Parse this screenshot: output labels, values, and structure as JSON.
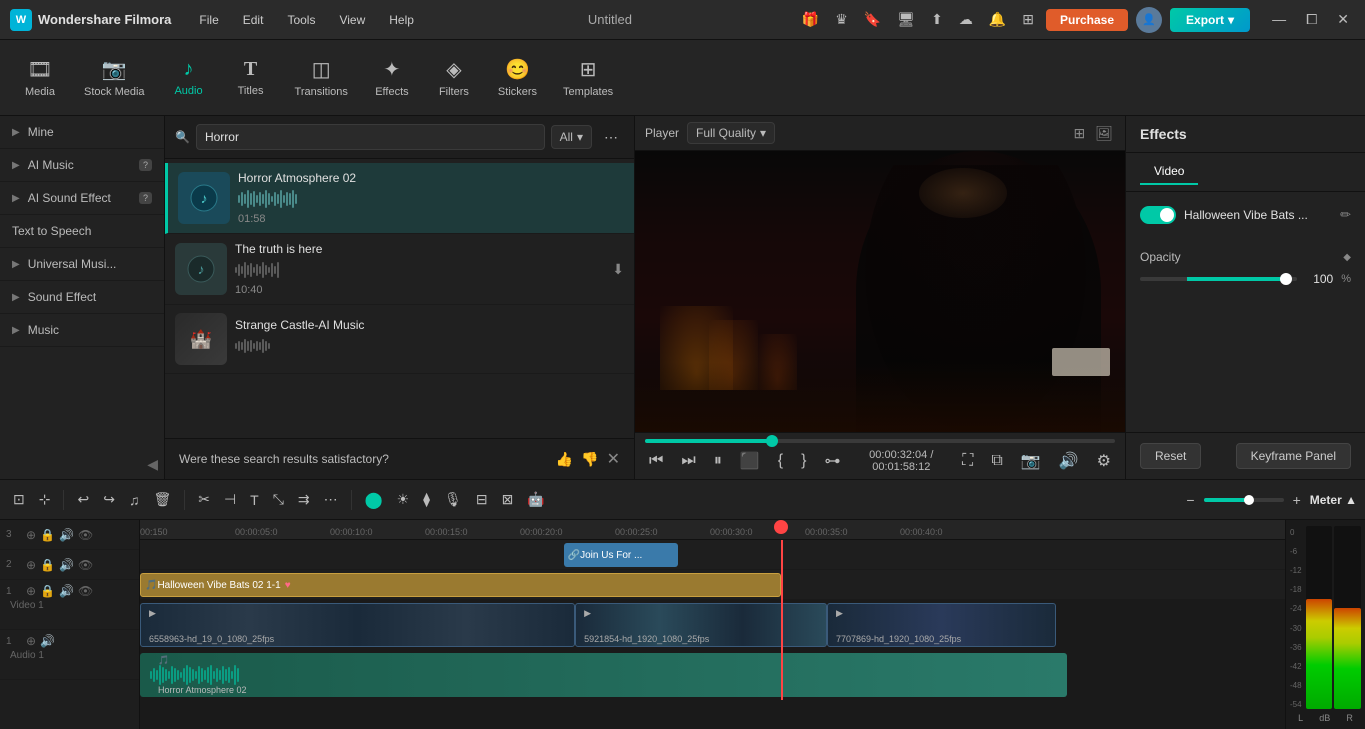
{
  "app": {
    "name": "Wondershare Filmora",
    "file_title": "Untitled"
  },
  "topbar": {
    "menus": [
      "File",
      "Edit",
      "Tools",
      "View",
      "Help"
    ],
    "purchase_label": "Purchase",
    "export_label": "Export",
    "window_controls": [
      "—",
      "⧠",
      "✕"
    ]
  },
  "toolbar": {
    "items": [
      {
        "id": "media",
        "label": "Media",
        "icon": "🎞"
      },
      {
        "id": "stock-media",
        "label": "Stock Media",
        "icon": "📷"
      },
      {
        "id": "audio",
        "label": "Audio",
        "icon": "♪"
      },
      {
        "id": "titles",
        "label": "Titles",
        "icon": "T"
      },
      {
        "id": "transitions",
        "label": "Transitions",
        "icon": "◫"
      },
      {
        "id": "effects",
        "label": "Effects",
        "icon": "✦"
      },
      {
        "id": "filters",
        "label": "Filters",
        "icon": "◈"
      },
      {
        "id": "stickers",
        "label": "Stickers",
        "icon": "😊"
      },
      {
        "id": "templates",
        "label": "Templates",
        "icon": "⊞"
      }
    ],
    "active": "audio"
  },
  "left_panel": {
    "items": [
      {
        "id": "mine",
        "label": "Mine",
        "arrow": "▶"
      },
      {
        "id": "ai-music",
        "label": "AI Music",
        "arrow": "▶",
        "badge": "?"
      },
      {
        "id": "ai-sound-effect",
        "label": "AI Sound Effect",
        "arrow": "▶",
        "badge": "?"
      },
      {
        "id": "text-to-speech",
        "label": "Text to Speech"
      },
      {
        "id": "universal-music",
        "label": "Universal Musi...",
        "arrow": "▶"
      },
      {
        "id": "sound-effect",
        "label": "Sound Effect",
        "arrow": "▶"
      },
      {
        "id": "music",
        "label": "Music",
        "arrow": "▶"
      }
    ]
  },
  "audio_panel": {
    "search": {
      "placeholder": "Horror",
      "filter_label": "All",
      "filter_icon": "▾"
    },
    "items": [
      {
        "id": "horror-atmosphere-02",
        "title": "Horror Atmosphere 02",
        "duration": "01:58",
        "active": true
      },
      {
        "id": "the-truth-is-here",
        "title": "The truth is here",
        "duration": "10:40",
        "active": false,
        "show_download": true
      },
      {
        "id": "strange-castle-ai-music",
        "title": "Strange Castle-AI Music",
        "duration": "",
        "active": false
      }
    ],
    "feedback": {
      "text": "Were these search results satisfactory?",
      "thumbs_up": "👍",
      "thumbs_down": "👎"
    }
  },
  "player": {
    "label": "Player",
    "quality": "Full Quality",
    "current_time": "00:00:32:04",
    "total_time": "00:01:58:12",
    "progress_percent": 27
  },
  "right_panel": {
    "title": "Effects",
    "tabs": [
      "Video"
    ],
    "active_tab": "Video",
    "toggle_label": "Halloween Vibe Bats ...",
    "opacity_label": "Opacity",
    "opacity_value": "100",
    "opacity_percent": "%",
    "reset_label": "Reset",
    "keyframe_label": "Keyframe Panel"
  },
  "timeline": {
    "toolbar": {
      "meter_label": "Meter ▲"
    },
    "ruler_marks": [
      {
        "label": "00:150",
        "pos": 0
      },
      {
        "label": "00:00:05:0",
        "pos": 11
      },
      {
        "label": "00:00:10:0",
        "pos": 23
      },
      {
        "label": "00:00:15:0",
        "pos": 35
      },
      {
        "label": "00:00:20:0",
        "pos": 47
      },
      {
        "label": "00:00:25:0",
        "pos": 59
      },
      {
        "label": "00:00:30:0",
        "pos": 71
      },
      {
        "label": "00:00:35:0",
        "pos": 83
      },
      {
        "label": "00:00:40:0",
        "pos": 95
      }
    ],
    "tracks": [
      {
        "num": "3",
        "type": "video-extra",
        "label": ""
      },
      {
        "num": "2",
        "type": "audio-main",
        "label": ""
      },
      {
        "num": "1",
        "type": "video",
        "label": "Video 1"
      },
      {
        "num": "1",
        "type": "audio",
        "label": "Audio 1"
      }
    ],
    "clips": {
      "join": "Join Us For ...",
      "halloween": "Halloween Vibe Bats 02 1-1",
      "video1": "6558963-hd_19_0_1080_25fps",
      "video2": "5921854-hd_1920_1080_25fps",
      "video3": "7707869-hd_1920_1080_25fps",
      "audio1": "Horror Atmosphere 02"
    },
    "meter": {
      "labels": [
        "0",
        "-6",
        "-12",
        "-18",
        "-24",
        "-30",
        "-36",
        "-42",
        "-48",
        "-54"
      ],
      "lr_label_l": "L",
      "lr_label_r": "R",
      "db_label": "dB"
    }
  }
}
